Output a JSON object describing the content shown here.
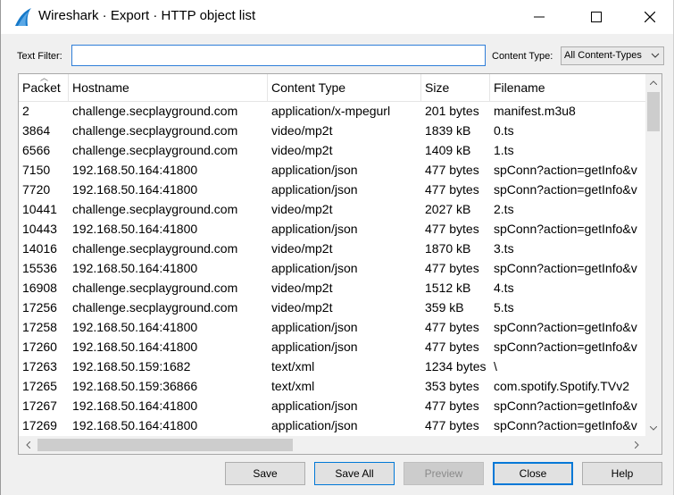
{
  "window": {
    "title": "Wireshark · Export · HTTP object list"
  },
  "filter": {
    "text_filter_label": "Text Filter:",
    "text_filter_value": "",
    "content_type_label": "Content Type:",
    "content_type_selected": "All Content-Types"
  },
  "table": {
    "columns": [
      "Packet",
      "Hostname",
      "Content Type",
      "Size",
      "Filename"
    ],
    "rows": [
      [
        "2",
        "challenge.secplayground.com",
        "application/x-mpegurl",
        "201 bytes",
        "manifest.m3u8"
      ],
      [
        "3864",
        "challenge.secplayground.com",
        "video/mp2t",
        "1839 kB",
        "0.ts"
      ],
      [
        "6566",
        "challenge.secplayground.com",
        "video/mp2t",
        "1409 kB",
        "1.ts"
      ],
      [
        "7150",
        "192.168.50.164:41800",
        "application/json",
        "477 bytes",
        "spConn?action=getInfo&v"
      ],
      [
        "7720",
        "192.168.50.164:41800",
        "application/json",
        "477 bytes",
        "spConn?action=getInfo&v"
      ],
      [
        "10441",
        "challenge.secplayground.com",
        "video/mp2t",
        "2027 kB",
        "2.ts"
      ],
      [
        "10443",
        "192.168.50.164:41800",
        "application/json",
        "477 bytes",
        "spConn?action=getInfo&v"
      ],
      [
        "14016",
        "challenge.secplayground.com",
        "video/mp2t",
        "1870 kB",
        "3.ts"
      ],
      [
        "15536",
        "192.168.50.164:41800",
        "application/json",
        "477 bytes",
        "spConn?action=getInfo&v"
      ],
      [
        "16908",
        "challenge.secplayground.com",
        "video/mp2t",
        "1512 kB",
        "4.ts"
      ],
      [
        "17256",
        "challenge.secplayground.com",
        "video/mp2t",
        "359 kB",
        "5.ts"
      ],
      [
        "17258",
        "192.168.50.164:41800",
        "application/json",
        "477 bytes",
        "spConn?action=getInfo&v"
      ],
      [
        "17260",
        "192.168.50.164:41800",
        "application/json",
        "477 bytes",
        "spConn?action=getInfo&v"
      ],
      [
        "17263",
        "192.168.50.159:1682",
        "text/xml",
        "1234 bytes",
        "\\"
      ],
      [
        "17265",
        "192.168.50.159:36866",
        "text/xml",
        "353 bytes",
        "com.spotify.Spotify.TVv2"
      ],
      [
        "17267",
        "192.168.50.164:41800",
        "application/json",
        "477 bytes",
        "spConn?action=getInfo&v"
      ],
      [
        "17269",
        "192.168.50.164:41800",
        "application/json",
        "477 bytes",
        "spConn?action=getInfo&v"
      ]
    ]
  },
  "buttons": {
    "save": "Save",
    "save_all": "Save All",
    "preview": "Preview",
    "close": "Close",
    "help": "Help"
  },
  "icons": {
    "app": "wireshark-fin-icon",
    "minimize": "minimize-icon",
    "maximize": "maximize-icon",
    "close": "close-icon"
  },
  "colors": {
    "accent": "#0078d7",
    "app_icon": "#1679c9"
  }
}
